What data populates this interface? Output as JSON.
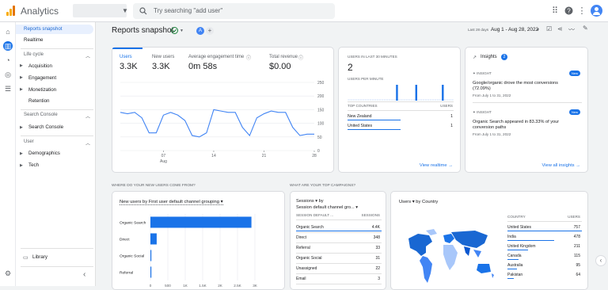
{
  "app": {
    "title": "Analytics"
  },
  "search": {
    "placeholder": "Try searching \"add user\""
  },
  "nav": {
    "reports_snapshot": "Reports snapshot",
    "realtime": "Realtime",
    "lifecycle": "Life cycle",
    "acquisition": "Acquisition",
    "engagement": "Engagement",
    "monetization": "Monetization",
    "retention": "Retention",
    "search_console_section": "Search Console",
    "search_console": "Search Console",
    "user_section": "User",
    "demographics": "Demographics",
    "tech": "Tech",
    "library": "Library"
  },
  "header": {
    "title": "Reports snapshot",
    "avatar_letter": "A",
    "date_label": "Last 28 days",
    "date_range": "Aug 1 - Aug 28, 2022"
  },
  "metrics": [
    {
      "label": "Users",
      "value": "3.3K"
    },
    {
      "label": "New users",
      "value": "3.3K"
    },
    {
      "label": "Average engagement time",
      "value": "0m 58s"
    },
    {
      "label": "Total revenue",
      "value": "$0.00"
    }
  ],
  "chart_data": [
    {
      "type": "line",
      "x": [
        "Aug 1",
        "Aug 2",
        "Aug 3",
        "Aug 4",
        "Aug 5",
        "Aug 6",
        "Aug 7",
        "Aug 8",
        "Aug 9",
        "Aug 10",
        "Aug 11",
        "Aug 12",
        "Aug 13",
        "Aug 14",
        "Aug 15",
        "Aug 16",
        "Aug 17",
        "Aug 18",
        "Aug 19",
        "Aug 20",
        "Aug 21",
        "Aug 22",
        "Aug 23",
        "Aug 24",
        "Aug 25",
        "Aug 26",
        "Aug 27",
        "Aug 28"
      ],
      "series": [
        {
          "values": [
            140,
            135,
            140,
            120,
            65,
            65,
            130,
            140,
            130,
            110,
            55,
            50,
            65,
            150,
            145,
            140,
            140,
            85,
            55,
            120,
            135,
            145,
            140,
            140,
            85,
            55,
            60,
            60
          ]
        }
      ],
      "xticks": [
        "07",
        "14",
        "21",
        "28"
      ],
      "xtick_sub": "Aug",
      "yticks": [
        "250",
        "200",
        "150",
        "100",
        "50",
        "0"
      ],
      "ylim": [
        0,
        250
      ],
      "grid": true
    },
    {
      "type": "bar",
      "title": "New users by First user default channel grouping",
      "orientation": "horizontal",
      "categories": [
        "Organic Search",
        "Direct",
        "Organic Social",
        "Referral"
      ],
      "values": [
        2900,
        180,
        15,
        10
      ],
      "xticks": [
        "0",
        "500",
        "1K",
        "1.5K",
        "2K",
        "2.5K",
        "3K"
      ],
      "xlim": [
        0,
        3000
      ]
    },
    {
      "type": "bar",
      "title": "Users in last 30 minutes per minute",
      "values": [
        0,
        0,
        0,
        0,
        0,
        0,
        0,
        0,
        0,
        0,
        0,
        0,
        0,
        0,
        0,
        0,
        0,
        0,
        0,
        0,
        1,
        0,
        0,
        0,
        0,
        0,
        0,
        0,
        1,
        0,
        0,
        0,
        0,
        0,
        0,
        0,
        0,
        0,
        0,
        1,
        0,
        0,
        0,
        0
      ]
    }
  ],
  "realtime": {
    "heading": "USERS IN LAST 30 MINUTES",
    "value": "2",
    "per_minute": "USERS PER MINUTE",
    "col1": "TOP COUNTRIES",
    "col2": "USERS",
    "rows": [
      {
        "name": "New Zealand",
        "value": "1"
      },
      {
        "name": "United States",
        "value": "1"
      }
    ],
    "link": "View realtime"
  },
  "insights": {
    "title": "Insights",
    "count": "2",
    "items": [
      {
        "tag": "INSIGHT",
        "badge": "New",
        "title": "Google/organic drove the most conversions (72.09%)",
        "sub": "From July 1 to 31, 2022"
      },
      {
        "tag": "INSIGHT",
        "badge": "New",
        "title": "Organic Search appeared in 83.33% of your conversion paths",
        "sub": "From July 1 to 31, 2022"
      }
    ],
    "link": "View all insights"
  },
  "section_labels": {
    "left": "WHERE DO YOUR NEW USERS COME FROM?",
    "right": "WHAT ARE YOUR TOP CAMPAIGNS?"
  },
  "campaigns": {
    "selector1": "Sessions",
    "by": "by",
    "selector2": "Session default channel gro...",
    "col1": "SESSION DEFAULT ...",
    "col2": "SESSIONS",
    "rows": [
      {
        "name": "Organic Search",
        "value": "4.4K"
      },
      {
        "name": "Direct",
        "value": "348"
      },
      {
        "name": "Referral",
        "value": "33"
      },
      {
        "name": "Organic Social",
        "value": "31"
      },
      {
        "name": "Unassigned",
        "value": "22"
      },
      {
        "name": "Email",
        "value": "3"
      }
    ]
  },
  "country": {
    "selector": "Users",
    "by": "by Country",
    "col1": "COUNTRY",
    "col2": "USERS",
    "rows": [
      {
        "name": "United States",
        "value": "757"
      },
      {
        "name": "India",
        "value": "478"
      },
      {
        "name": "United Kingdom",
        "value": "211"
      },
      {
        "name": "Canada",
        "value": "115"
      },
      {
        "name": "Australia",
        "value": "95"
      },
      {
        "name": "Pakistan",
        "value": "64"
      }
    ]
  }
}
